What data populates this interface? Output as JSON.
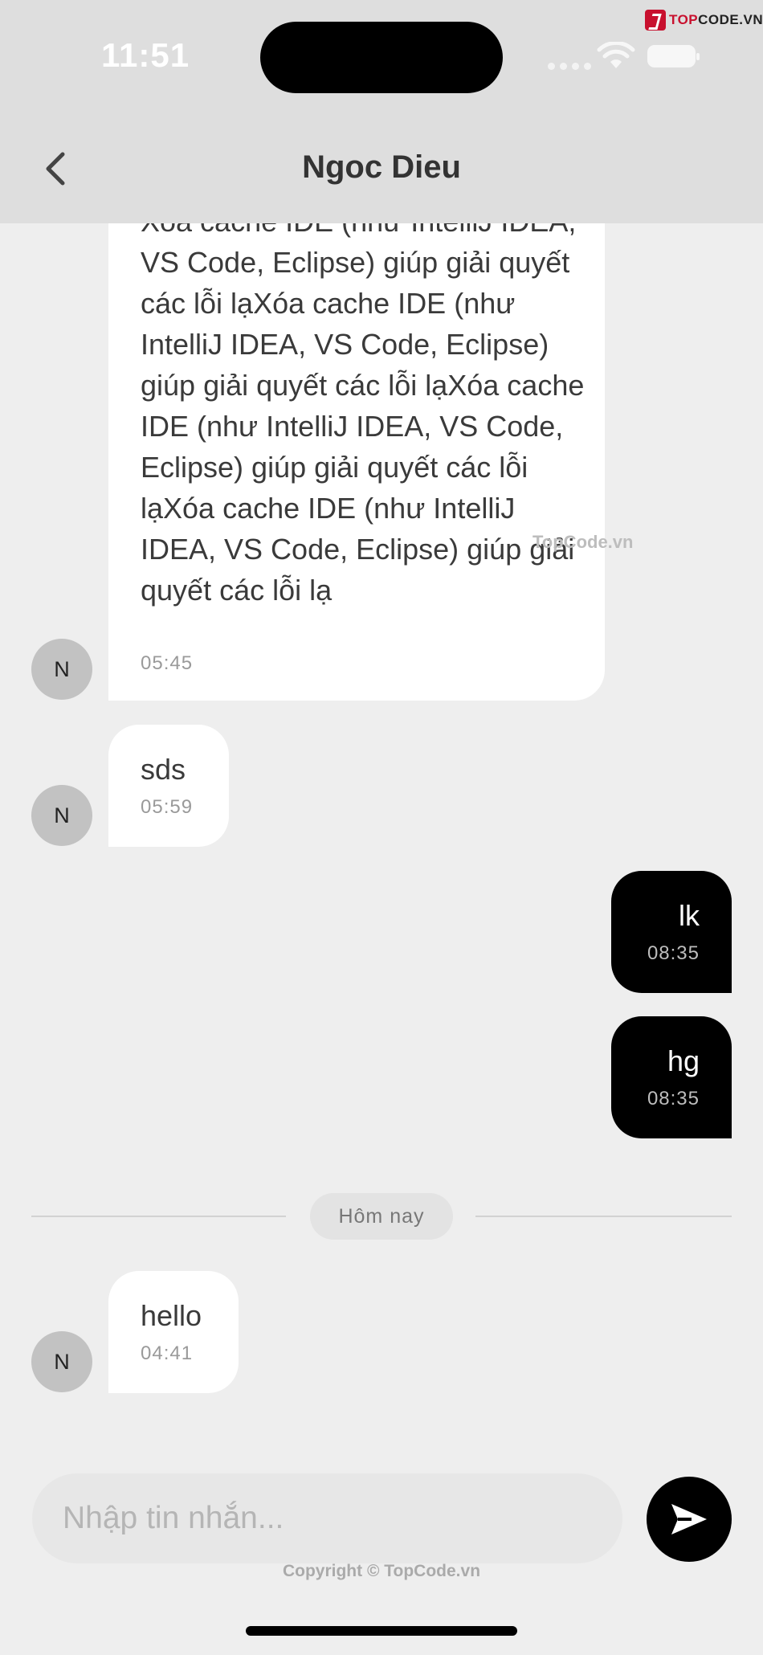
{
  "status_bar": {
    "time": "11:51"
  },
  "watermark": {
    "brand_prefix": "TOP",
    "brand_suffix": "CODE.VN",
    "middle": "TopCode.vn",
    "copyright": "Copyright © TopCode.vn"
  },
  "header": {
    "title": "Ngoc Dieu"
  },
  "messages": [
    {
      "direction": "incoming",
      "avatar": "N",
      "text": "Xóa cache IDE (như IntelliJ IDEA, VS Code, Eclipse) giúp giải quyết các lỗi lạXóa cache IDE (như IntelliJ IDEA, VS Code, Eclipse) giúp giải quyết các lỗi lạXóa cache IDE (như IntelliJ IDEA, VS Code, Eclipse) giúp giải quyết các lỗi lạXóa cache IDE (như IntelliJ IDEA, VS Code, Eclipse) giúp giải quyết các lỗi lạ",
      "time": "05:45"
    },
    {
      "direction": "incoming",
      "avatar": "N",
      "text": "sds",
      "time": "05:59"
    },
    {
      "direction": "outgoing",
      "text": "lk",
      "time": "08:35"
    },
    {
      "direction": "outgoing",
      "text": "hg",
      "time": "08:35"
    },
    {
      "direction": "incoming",
      "avatar": "N",
      "text": "hello",
      "time": "04:41"
    }
  ],
  "date_divider": "Hôm nay",
  "composer": {
    "placeholder": "Nhập tin nhắn...",
    "value": ""
  },
  "colors": {
    "outgoing_bubble": "#000000",
    "incoming_bubble": "#ffffff",
    "background": "#eeeeee",
    "header": "#dedede"
  }
}
